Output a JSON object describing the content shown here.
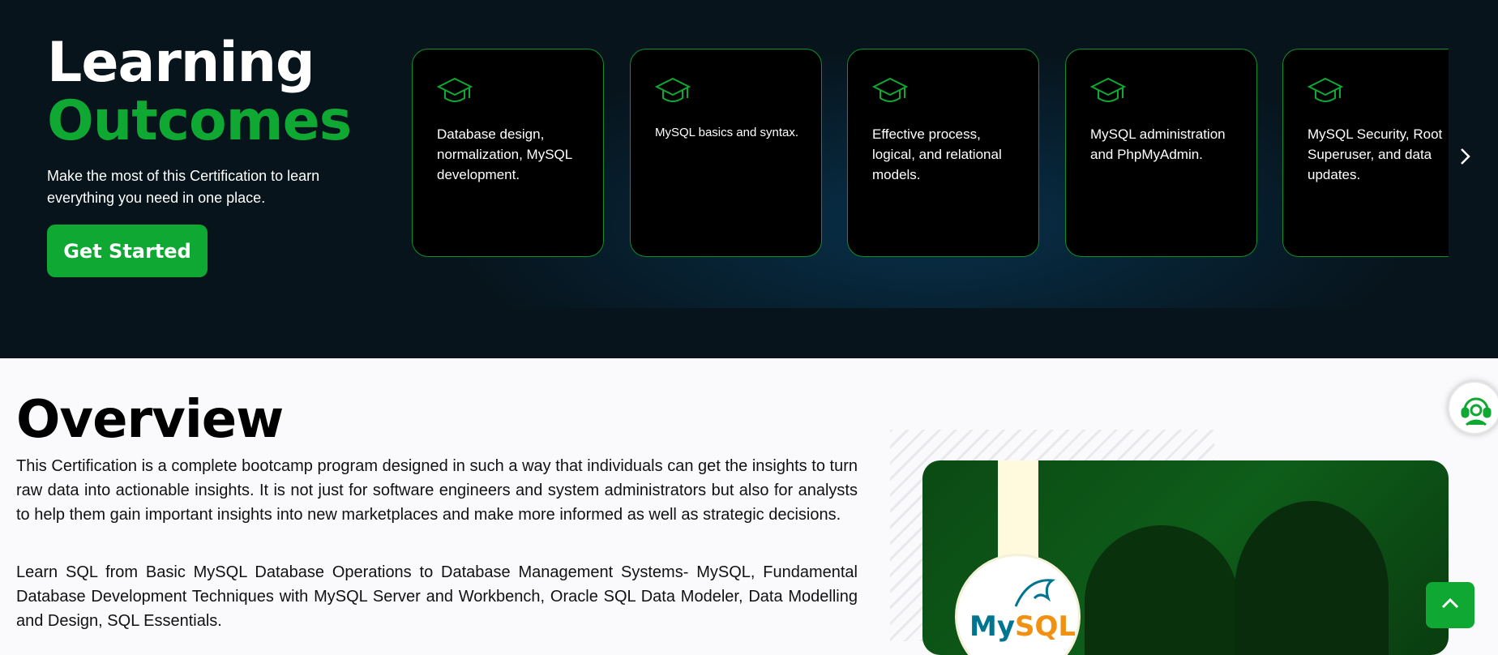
{
  "hero": {
    "title_line1": "Learning",
    "title_line2": "Outcomes",
    "subtitle": "Make the most of this Certification to learn everything you need in one place.",
    "cta_label": "Get Started"
  },
  "cards": [
    {
      "text": "Database design, normalization, MySQL development."
    },
    {
      "text": "MySQL basics and syntax."
    },
    {
      "text": "Effective process, logical, and relational models."
    },
    {
      "text": "MySQL administration and PhpMyAdmin."
    },
    {
      "text": "MySQL Security, Root Superuser, and data updates."
    }
  ],
  "overview": {
    "title": "Overview",
    "para1": "This Certification is a complete bootcamp program designed in such a way that individuals can get the insights to turn raw data into actionable insights. It is not just for software engineers and system administrators but also for analysts to help them gain important insights into new marketplaces and make more informed as well as strategic decisions.",
    "para2": "Learn SQL from Basic MySQL Database Operations to Database Management Systems- MySQL, Fundamental Database Development Techniques with MySQL Server and Workbench, Oracle SQL Data Modeler, Data Modelling and Design, SQL Essentials.",
    "logo_my": "My",
    "logo_sql": "SQL"
  },
  "colors": {
    "brand_green": "#0fa833",
    "hero_bg": "#07141c",
    "card_bg": "#000000"
  }
}
